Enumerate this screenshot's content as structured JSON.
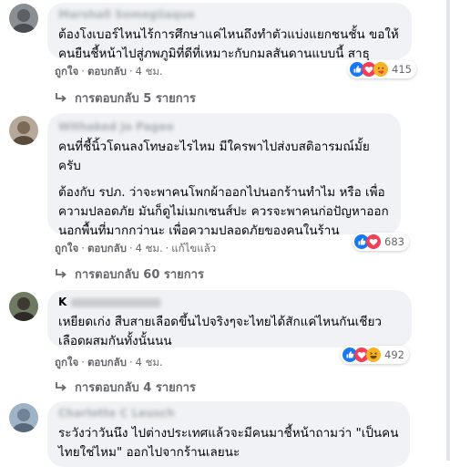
{
  "comments": [
    {
      "author": "Marshall Somegiiaque",
      "lines": [
        "ต้องโงเบอร์ไหนไร้การศึกษาแค่ไหนถึงทำตัวแบ่งแยกชนชั้น ขอให้คนยืนชี้หน้าไปสู่ภพภูมิที่ดีที่เหมาะกับกมลสันดานแบบนี้ สาธุ"
      ],
      "like": "ถูกใจ",
      "reply": "ตอบกลับ",
      "time": "4 ชม.",
      "edited": "",
      "reaction_count": "415",
      "replies_label": "การตอบกลับ 5 รายการ"
    },
    {
      "author": "Withaked Jo Pageo",
      "lines": [
        "คนที่ชี้นิ้วโดนลงโทษอะไรไหม มีใครพาไปส่งบสติอารมณ์มั้ย ครับ",
        "ต้องกับ รปภ. ว่าจะพาคนโพกผ้าออกไปนอกร้านทำไม หรือ เพื่อความปลอดภัย มันก็ดูไม่เมกเซนส์ปะ ควรจะพาคนก่อปัญหาออกนอกพื้นที่มากกว่านะ เพื่อความปลอดภัยของคนในร้าน"
      ],
      "like": "ถูกใจ",
      "reply": "ตอบกลับ",
      "time": "4 ชม.",
      "edited": "แก้ไขแล้ว",
      "reaction_count": "683",
      "replies_label": "การตอบกลับ 60 รายการ"
    },
    {
      "author": "K",
      "lines": [
        "เหยียดเก่ง สืบสายเลือดขึ้นไปจริงๆจะไทยได้สักแค่ไหนกันเชียว เลือดผสมกันทั้งนั้นนน"
      ],
      "like": "ถูกใจ",
      "reply": "ตอบกลับ",
      "time": "4 ชม.",
      "edited": "",
      "reaction_count": "492",
      "replies_label": "การตอบกลับ 4 รายการ"
    },
    {
      "author": "Charlotte C Leusch",
      "lines": [
        "ระวังว่าวันนึง ไปต่างประเทศแล้วจะมีคนมาชี้หน้าถามว่า \"เป็นคนไทยใช่ไหม\" ออกไปจากร้านเลยนะ"
      ]
    }
  ],
  "colors": {
    "bubble": "#f0f2f5",
    "meta": "#65676b",
    "like_blue": "#1877f2",
    "love_red": "#f33e58",
    "haha_yellow": "#f7b125"
  },
  "icons": [
    "like-icon",
    "love-icon",
    "haha-icon",
    "care-icon",
    "reply-arrow-icon"
  ]
}
